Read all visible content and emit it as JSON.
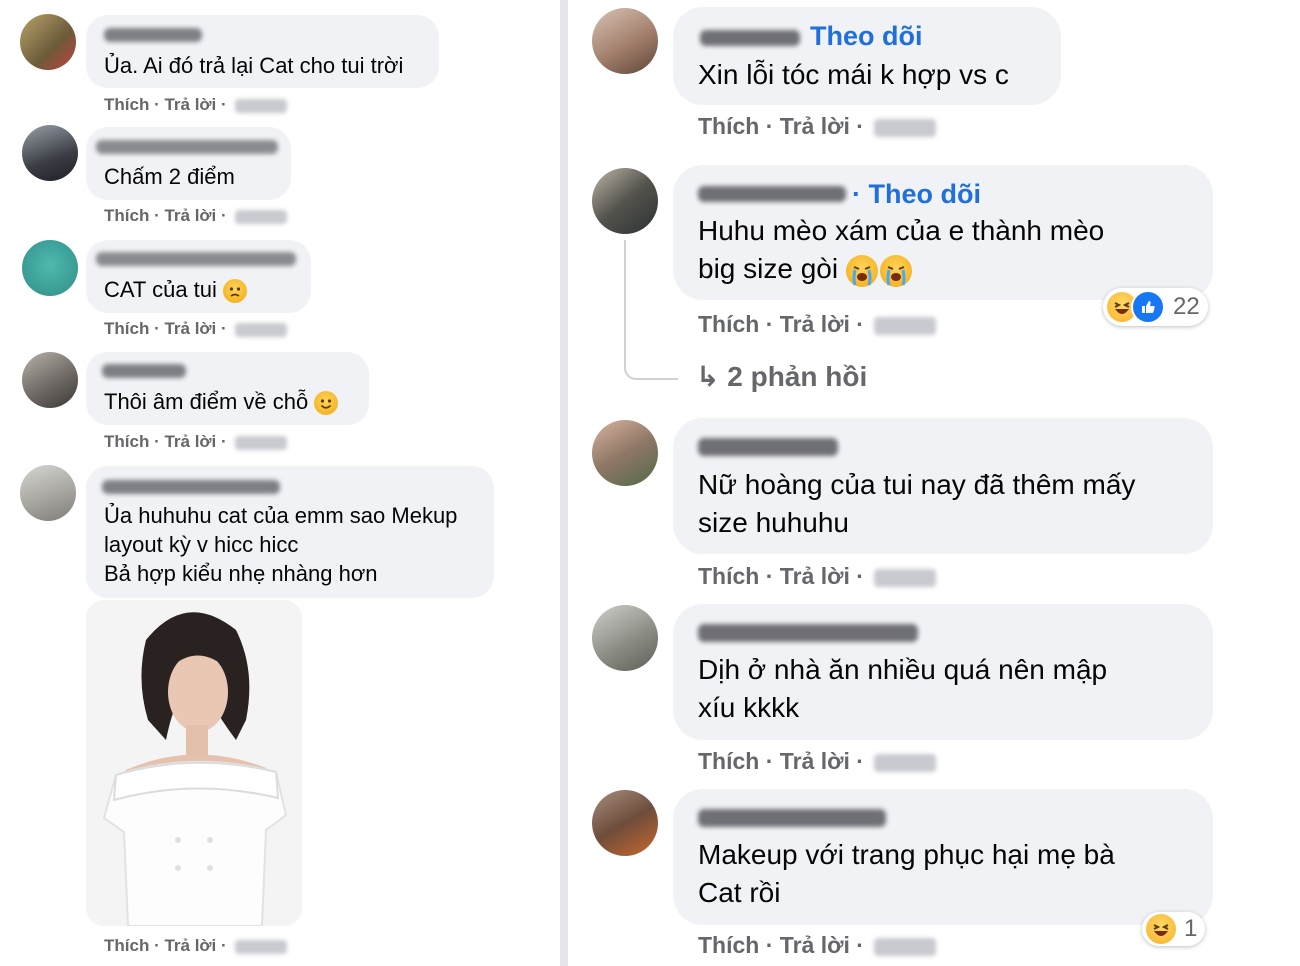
{
  "actions": {
    "like": "Thích",
    "reply": "Trả lời",
    "sep": " · "
  },
  "follow_label": "Theo dõi",
  "left_comments": [
    {
      "text": "Ủa. Ai đó trả lại Cat cho tui trời"
    },
    {
      "text": "Chấm 2 điểm"
    },
    {
      "text": "CAT của tui",
      "emoji": "sad-face"
    },
    {
      "text": "Thôi âm điểm về chỗ",
      "emoji": "smile-face"
    },
    {
      "text": "Ủa huhuhu cat của emm sao Mekup\nlayout kỳ v hicc hicc\nBả hợp kiểu nhẹ nhàng hơn"
    }
  ],
  "right_comments": [
    {
      "text": "Xin lỗi tóc mái k hợp vs c"
    },
    {
      "text": "Huhu mèo xám của e thành mèo\nbig size gòi",
      "emoji": "crying-face",
      "reaction_count": "22",
      "reactions": [
        "haha-icon",
        "like-icon"
      ]
    },
    {
      "text": "Nữ hoàng của tui nay đã thêm mấy\nsize huhuhu"
    },
    {
      "text": "Dịh ở nhà ăn nhiều quá nên mập\nxíu kkkk"
    },
    {
      "text": "Makeup với trang phục hại mẹ bà\nCat rồi",
      "reaction_count": "1",
      "reactions": [
        "haha-icon"
      ]
    }
  ],
  "replies_link": "2 phản hồi",
  "colors": {
    "bubble": "#f0f2f5",
    "link": "#216fdb",
    "muted": "#65676b"
  }
}
